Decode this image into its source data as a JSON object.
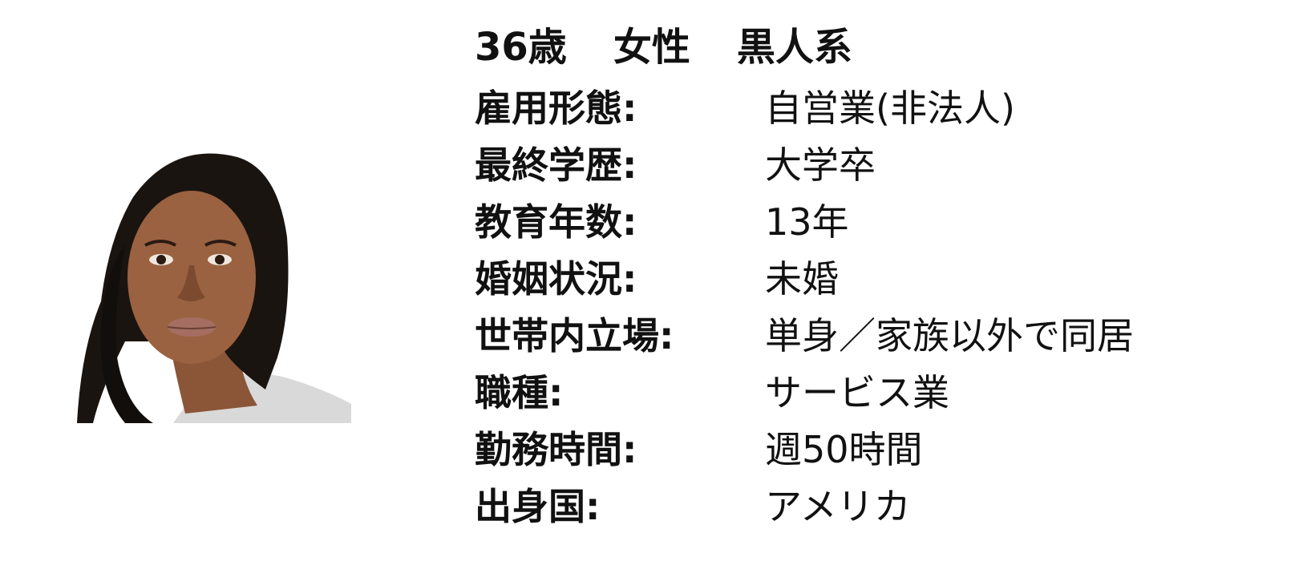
{
  "profile": {
    "age": "36歳",
    "gender": "女性",
    "ethnicity": "黒人系"
  },
  "rows": [
    {
      "label": "雇用形態:",
      "value": "自営業(非法人)"
    },
    {
      "label": "最終学歴:",
      "value": "大学卒"
    },
    {
      "label": "教育年数:",
      "value": "13年"
    },
    {
      "label": "婚姻状況:",
      "value": "未婚"
    },
    {
      "label": "世帯内立場:",
      "value": "単身／家族以外で同居"
    },
    {
      "label": "職種:",
      "value": "サービス業"
    },
    {
      "label": "勤務時間:",
      "value": "週50時間"
    },
    {
      "label": "出身国:",
      "value": "アメリカ"
    }
  ]
}
